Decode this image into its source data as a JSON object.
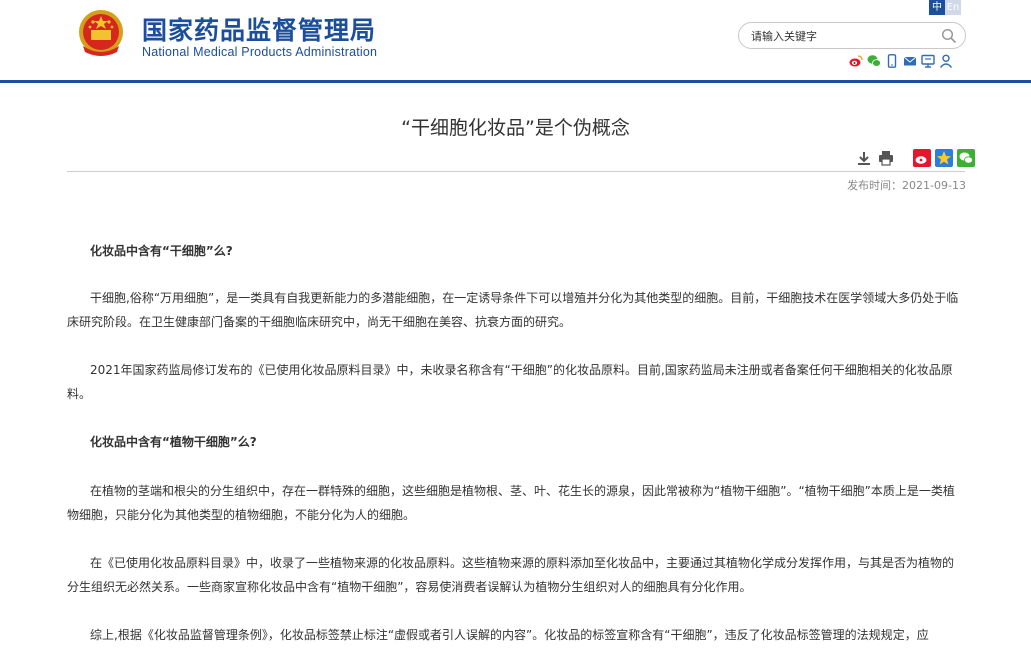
{
  "header": {
    "logo_cn": "国家药品监督管理局",
    "logo_en": "National Medical Products Administration",
    "lang_zh": "中",
    "lang_en": "En",
    "search_placeholder": "请输入关键字",
    "social_icons": [
      "weibo-icon",
      "wechat-icon",
      "mobile-icon",
      "email-icon",
      "message-icon",
      "user-icon"
    ]
  },
  "article": {
    "title": "“干细胞化妆品”是个伪概念",
    "tools": [
      "download-icon",
      "print-icon",
      "share-weibo-icon",
      "share-qzone-icon",
      "share-wechat-icon"
    ],
    "date_label": "发布时间：2021-09-13",
    "heading1": "化妆品中含有“干细胞”么?",
    "p1": "干细胞,俗称“万用细胞”，是一类具有自我更新能力的多潜能细胞，在一定诱导条件下可以增殖并分化为其他类型的细胞。目前，干细胞技术在医学领域大多仍处于临床研究阶段。在卫生健康部门备案的干细胞临床研究中，尚无干细胞在美容、抗衰方面的研究。",
    "p2": "2021年国家药监局修订发布的《已使用化妆品原料目录》中，未收录名称含有“干细胞”的化妆品原料。目前,国家药监局未注册或者备案任何干细胞相关的化妆品原料。",
    "heading2": "化妆品中含有“植物干细胞”么?",
    "p3": "在植物的茎端和根尖的分生组织中，存在一群特殊的细胞，这些细胞是植物根、茎、叶、花生长的源泉，因此常被称为“植物干细胞”。“植物干细胞”本质上是一类植物细胞，只能分化为其他类型的植物细胞，不能分化为人的细胞。",
    "p4": "在《已使用化妆品原料目录》中，收录了一些植物来源的化妆品原料。这些植物来源的原料添加至化妆品中，主要通过其植物化学成分发挥作用，与其是否为植物的分生组织无必然关系。一些商家宣称化妆品中含有“植物干细胞”，容易使消费者误解认为植物分生组织对人的细胞具有分化作用。",
    "p5": "综上,根据《化妆品监督管理条例》，化妆品标签禁止标注“虚假或者引人误解的内容”。化妆品的标签宣称含有“干细胞”，违反了化妆品标签管理的法规规定，应"
  },
  "colors": {
    "brand_blue": "#1b4e9b",
    "header_rule": "#1c4f9c"
  }
}
